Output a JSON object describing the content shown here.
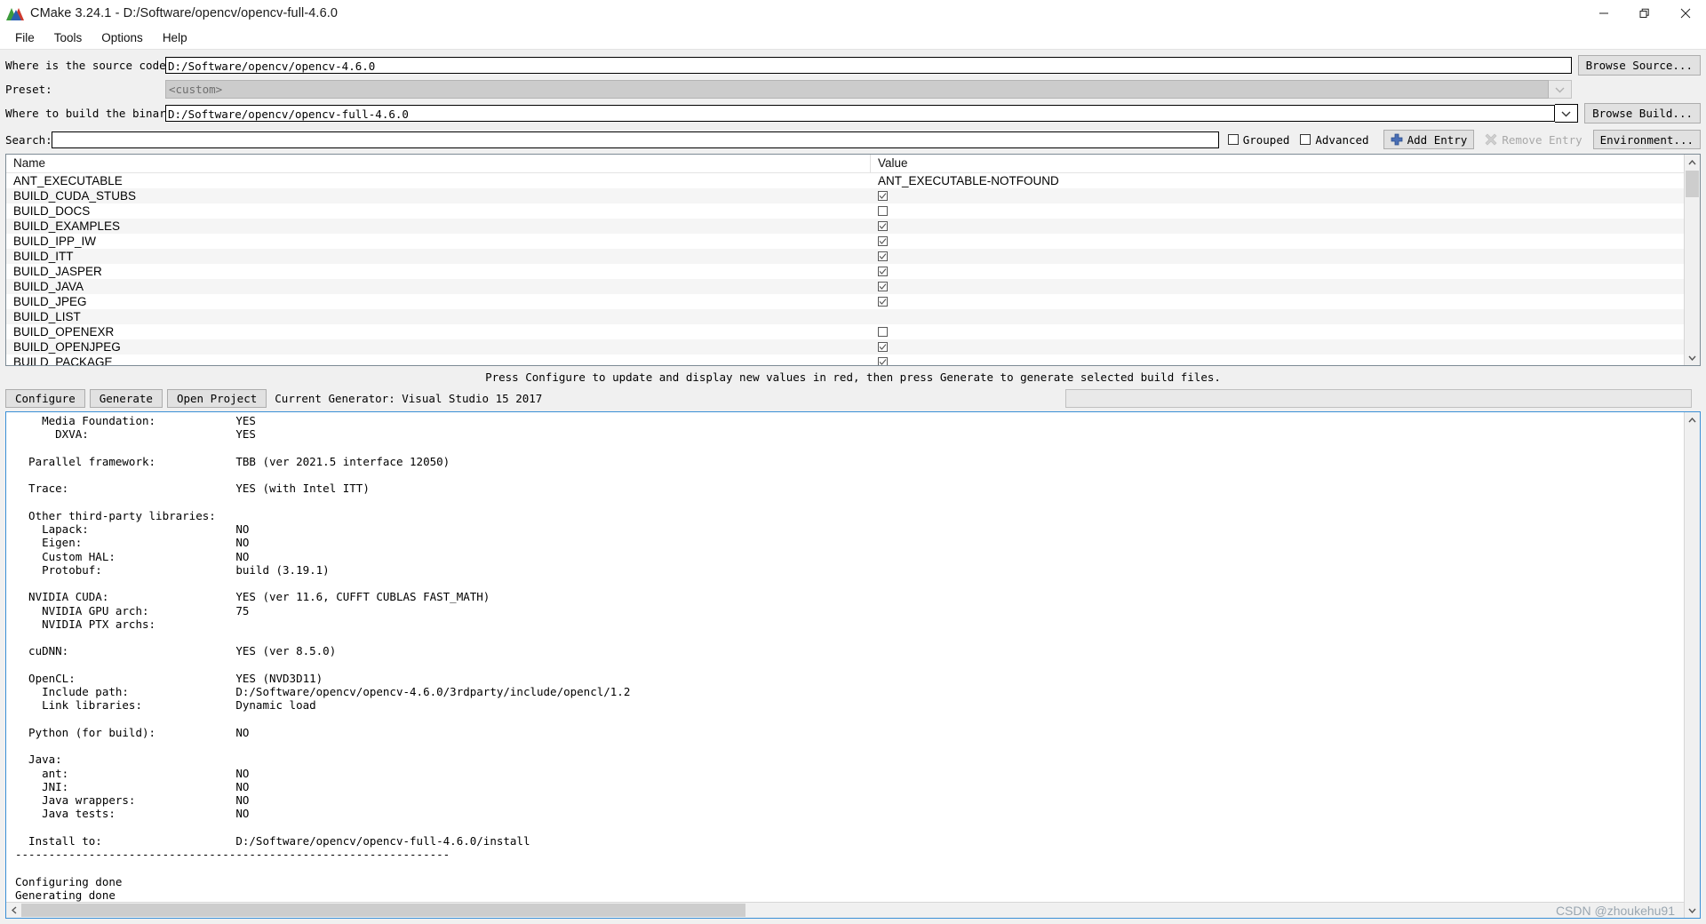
{
  "window": {
    "title": "CMake 3.24.1 - D:/Software/opencv/opencv-full-4.6.0",
    "icon": "cmake-logo-icon",
    "minimize_label": "—",
    "maximize_label": "❐",
    "close_label": "✕"
  },
  "menu": {
    "items": [
      {
        "label": "File"
      },
      {
        "label": "Tools"
      },
      {
        "label": "Options"
      },
      {
        "label": "Help"
      }
    ]
  },
  "form": {
    "source_label": "Where is the source code:",
    "source_value": "D:/Software/opencv/opencv-4.6.0",
    "browse_source_label": "Browse Source...",
    "preset_label": "Preset:",
    "preset_value": "<custom>",
    "binaries_label": "Where to build the binaries:",
    "binaries_value": "D:/Software/opencv/opencv-full-4.6.0",
    "browse_build_label": "Browse Build..."
  },
  "search": {
    "label": "Search:",
    "value": "",
    "placeholder": "",
    "grouped_label": "Grouped",
    "grouped_checked": false,
    "advanced_label": "Advanced",
    "advanced_checked": false,
    "add_entry_label": "Add Entry",
    "add_entry_icon": "plus-icon",
    "remove_entry_label": "Remove Entry",
    "remove_entry_icon": "remove-x-icon",
    "remove_entry_disabled": true,
    "environment_label": "Environment..."
  },
  "cache_table": {
    "columns": [
      "Name",
      "Value"
    ],
    "rows": [
      {
        "name": "ANT_EXECUTABLE",
        "type": "text",
        "value": "ANT_EXECUTABLE-NOTFOUND"
      },
      {
        "name": "BUILD_CUDA_STUBS",
        "type": "checkbox",
        "checked": true
      },
      {
        "name": "BUILD_DOCS",
        "type": "checkbox",
        "checked": false
      },
      {
        "name": "BUILD_EXAMPLES",
        "type": "checkbox",
        "checked": true
      },
      {
        "name": "BUILD_IPP_IW",
        "type": "checkbox",
        "checked": true
      },
      {
        "name": "BUILD_ITT",
        "type": "checkbox",
        "checked": true
      },
      {
        "name": "BUILD_JASPER",
        "type": "checkbox",
        "checked": true
      },
      {
        "name": "BUILD_JAVA",
        "type": "checkbox",
        "checked": true
      },
      {
        "name": "BUILD_JPEG",
        "type": "checkbox",
        "checked": true
      },
      {
        "name": "BUILD_LIST",
        "type": "text",
        "value": ""
      },
      {
        "name": "BUILD_OPENEXR",
        "type": "checkbox",
        "checked": false
      },
      {
        "name": "BUILD_OPENJPEG",
        "type": "checkbox",
        "checked": true
      },
      {
        "name": "BUILD_PACKAGE",
        "type": "checkbox",
        "checked": true
      }
    ]
  },
  "hint": {
    "text": "Press Configure to update and display new values in red, then press Generate to generate selected build files."
  },
  "actions": {
    "configure_label": "Configure",
    "generate_label": "Generate",
    "open_project_label": "Open Project",
    "current_generator_text": "Current Generator: Visual Studio 15 2017",
    "progress_value": ""
  },
  "log": {
    "content": "    Media Foundation:            YES\n      DXVA:                      YES\n\n  Parallel framework:            TBB (ver 2021.5 interface 12050)\n\n  Trace:                         YES (with Intel ITT)\n\n  Other third-party libraries:\n    Lapack:                      NO\n    Eigen:                       NO\n    Custom HAL:                  NO\n    Protobuf:                    build (3.19.1)\n\n  NVIDIA CUDA:                   YES (ver 11.6, CUFFT CUBLAS FAST_MATH)\n    NVIDIA GPU arch:             75\n    NVIDIA PTX archs:\n\n  cuDNN:                         YES (ver 8.5.0)\n\n  OpenCL:                        YES (NVD3D11)\n    Include path:                D:/Software/opencv/opencv-4.6.0/3rdparty/include/opencl/1.2\n    Link libraries:              Dynamic load\n\n  Python (for build):            NO\n\n  Java:\n    ant:                         NO\n    JNI:                         NO\n    Java wrappers:               NO\n    Java tests:                  NO\n\n  Install to:                    D:/Software/opencv/opencv-full-4.6.0/install\n-----------------------------------------------------------------\n\nConfiguring done\nGenerating done",
    "watermark": "CSDN @zhoukehu91"
  },
  "colors": {
    "accent": "#3a8fd6",
    "window_bg": "#f0f0f0",
    "field_bg": "#ffffff",
    "row_alt": "#f5f5f5",
    "button_bg": "#e1e1e1",
    "disabled_text": "#a8a8a8"
  }
}
